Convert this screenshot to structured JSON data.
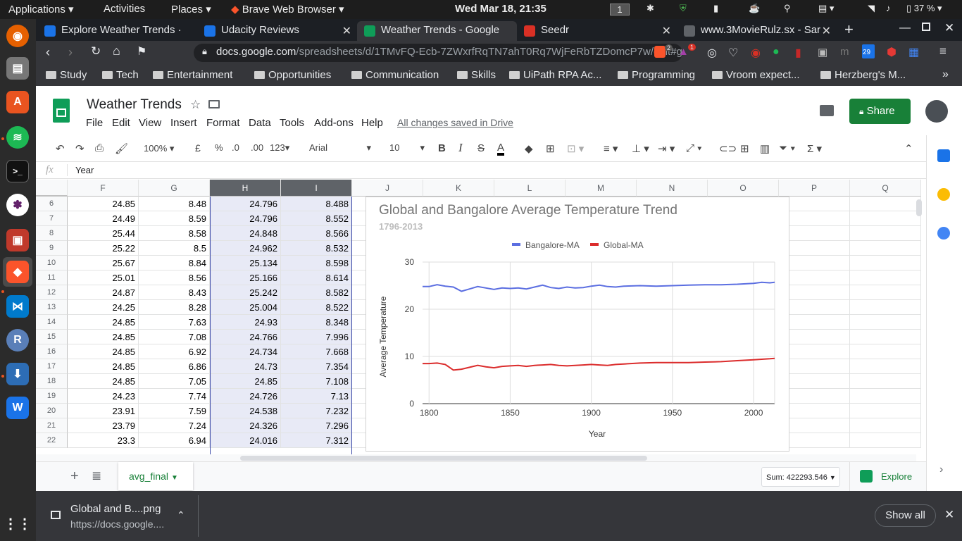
{
  "system_bar": {
    "applications": "Applications",
    "activities": "Activities",
    "places": "Places",
    "browser_app": "Brave Web Browser",
    "datetime": "Wed Mar 18, 21:35",
    "workspace": "1",
    "battery": "37 %"
  },
  "tabs": [
    {
      "title": "Explore Weather Trends ·",
      "color": "#1a73e8"
    },
    {
      "title": "Udacity Reviews",
      "color": "#1a73e8"
    },
    {
      "title": "Weather Trends - Google",
      "color": "#0f9d58"
    },
    {
      "title": "Seedr",
      "color": "#d93025"
    },
    {
      "title": "www.3MovieRulz.sx - Sar",
      "color": "#5f6368"
    }
  ],
  "address": {
    "host": "docs.google.com",
    "path": "/spreadsheets/d/1TMvFQ-Ecb-7ZWxrfRqTN7ahT0Rq7WjFeRbTZDomcP7w/edit#gid=...",
    "brave_count": "2",
    "alert_count": "1",
    "calendar_badge": "29"
  },
  "bookmarks": [
    "Study",
    "Tech",
    "Entertainment",
    "Opportunities",
    "Communication",
    "Skills",
    "UiPath RPA Ac...",
    "Programming",
    "Vroom expect...",
    "Herzberg's M..."
  ],
  "sheet": {
    "title": "Weather Trends",
    "menu": [
      "File",
      "Edit",
      "View",
      "Insert",
      "Format",
      "Data",
      "Tools",
      "Add-ons",
      "Help"
    ],
    "save_status": "All changes saved in Drive",
    "share_label": "Share"
  },
  "toolbar": {
    "zoom": "100%",
    "currency": "£",
    "percent": "%",
    "dec_less": ".0",
    "dec_more": ".00",
    "format": "123",
    "font": "Arial",
    "size": "10"
  },
  "formula_bar": {
    "fx": "fx",
    "value": "Year"
  },
  "columns": [
    "F",
    "G",
    "H",
    "I",
    "J",
    "K",
    "L",
    "M",
    "N",
    "O",
    "P",
    "Q"
  ],
  "rows": [
    {
      "n": "6",
      "F": "24.85",
      "G": "8.48",
      "H": "24.796",
      "I": "8.488"
    },
    {
      "n": "7",
      "F": "24.49",
      "G": "8.59",
      "H": "24.796",
      "I": "8.552"
    },
    {
      "n": "8",
      "F": "25.44",
      "G": "8.58",
      "H": "24.848",
      "I": "8.566"
    },
    {
      "n": "9",
      "F": "25.22",
      "G": "8.5",
      "H": "24.962",
      "I": "8.532"
    },
    {
      "n": "10",
      "F": "25.67",
      "G": "8.84",
      "H": "25.134",
      "I": "8.598"
    },
    {
      "n": "11",
      "F": "25.01",
      "G": "8.56",
      "H": "25.166",
      "I": "8.614"
    },
    {
      "n": "12",
      "F": "24.87",
      "G": "8.43",
      "H": "25.242",
      "I": "8.582"
    },
    {
      "n": "13",
      "F": "24.25",
      "G": "8.28",
      "H": "25.004",
      "I": "8.522"
    },
    {
      "n": "14",
      "F": "24.85",
      "G": "7.63",
      "H": "24.93",
      "I": "8.348"
    },
    {
      "n": "15",
      "F": "24.85",
      "G": "7.08",
      "H": "24.766",
      "I": "7.996"
    },
    {
      "n": "16",
      "F": "24.85",
      "G": "6.92",
      "H": "24.734",
      "I": "7.668"
    },
    {
      "n": "17",
      "F": "24.85",
      "G": "6.86",
      "H": "24.73",
      "I": "7.354"
    },
    {
      "n": "18",
      "F": "24.85",
      "G": "7.05",
      "H": "24.85",
      "I": "7.108"
    },
    {
      "n": "19",
      "F": "24.23",
      "G": "7.74",
      "H": "24.726",
      "I": "7.13"
    },
    {
      "n": "20",
      "F": "23.91",
      "G": "7.59",
      "H": "24.538",
      "I": "7.232"
    },
    {
      "n": "21",
      "F": "23.79",
      "G": "7.24",
      "H": "24.326",
      "I": "7.296"
    },
    {
      "n": "22",
      "F": "23.3",
      "G": "6.94",
      "H": "24.016",
      "I": "7.312"
    }
  ],
  "chart_data": {
    "type": "line",
    "title": "Global and Bangalore Average Temperature Trend",
    "subtitle": "1796-2013",
    "xlabel": "Year",
    "ylabel": "Average Temperature",
    "xlim": [
      1796,
      2013
    ],
    "ylim": [
      0,
      30
    ],
    "xticks": [
      1800,
      1850,
      1900,
      1950,
      2000
    ],
    "yticks": [
      0,
      10,
      20,
      30
    ],
    "grid": true,
    "legend_position": "top",
    "series": [
      {
        "name": "Bangalore-MA",
        "color": "#5b6ee1",
        "x": [
          1796,
          1800,
          1805,
          1810,
          1815,
          1820,
          1825,
          1830,
          1835,
          1840,
          1845,
          1850,
          1855,
          1860,
          1865,
          1870,
          1875,
          1880,
          1885,
          1890,
          1895,
          1900,
          1905,
          1910,
          1915,
          1920,
          1930,
          1940,
          1950,
          1960,
          1970,
          1980,
          1990,
          2000,
          2005,
          2010,
          2013
        ],
        "y": [
          24.8,
          24.8,
          25.2,
          24.9,
          24.7,
          23.8,
          24.3,
          24.8,
          24.5,
          24.2,
          24.5,
          24.4,
          24.5,
          24.3,
          24.7,
          25.1,
          24.6,
          24.4,
          24.7,
          24.5,
          24.6,
          24.9,
          25.1,
          24.8,
          24.7,
          24.9,
          25.0,
          24.9,
          25.0,
          25.1,
          25.2,
          25.2,
          25.3,
          25.5,
          25.7,
          25.6,
          25.7
        ]
      },
      {
        "name": "Global-MA",
        "color": "#db2c2c",
        "x": [
          1796,
          1800,
          1805,
          1810,
          1815,
          1820,
          1825,
          1830,
          1835,
          1840,
          1845,
          1850,
          1855,
          1860,
          1865,
          1870,
          1875,
          1880,
          1885,
          1890,
          1895,
          1900,
          1905,
          1910,
          1915,
          1920,
          1930,
          1940,
          1950,
          1960,
          1970,
          1980,
          1990,
          2000,
          2005,
          2010,
          2013
        ],
        "y": [
          8.5,
          8.5,
          8.6,
          8.3,
          7.1,
          7.3,
          7.7,
          8.1,
          7.8,
          7.6,
          7.9,
          8.0,
          8.1,
          7.9,
          8.1,
          8.2,
          8.3,
          8.1,
          8.0,
          8.1,
          8.2,
          8.3,
          8.2,
          8.1,
          8.3,
          8.4,
          8.6,
          8.7,
          8.7,
          8.7,
          8.8,
          8.9,
          9.1,
          9.3,
          9.4,
          9.5,
          9.6
        ]
      }
    ]
  },
  "sheet_tab": {
    "name": "avg_final",
    "sum": "Sum: 422293.546",
    "explore": "Explore"
  },
  "download": {
    "file": "Global and B....png",
    "url": "https://docs.google....",
    "show_all": "Show all"
  }
}
